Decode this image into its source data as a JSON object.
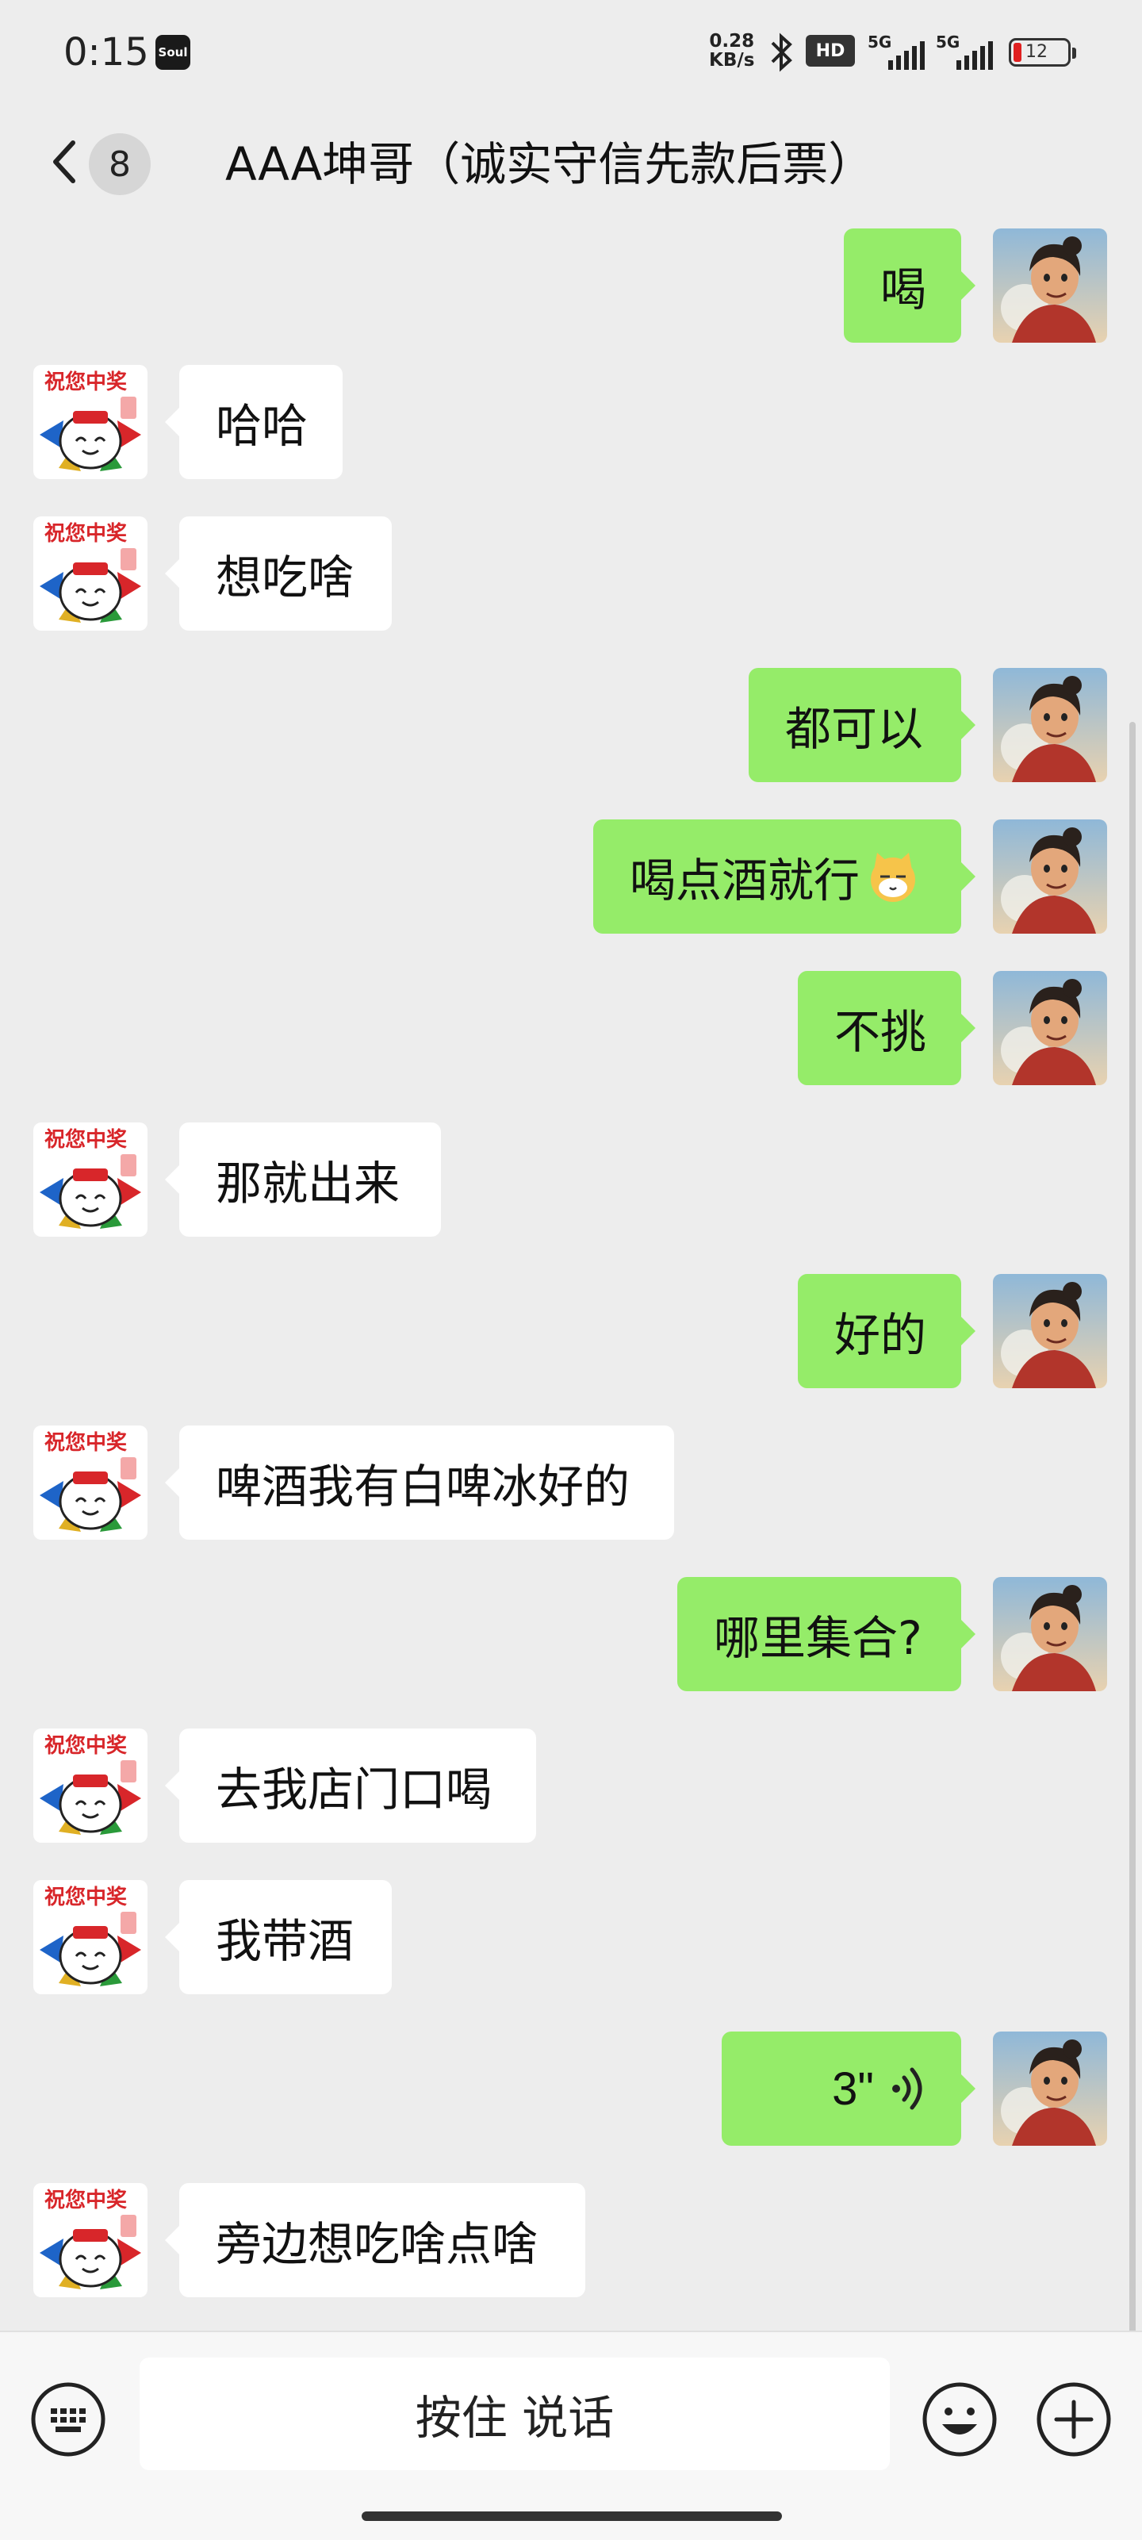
{
  "status_bar": {
    "time": "0:15",
    "app_icon_label": "Soul",
    "net_speed_value": "0.28",
    "net_speed_unit": "KB/s",
    "hd_label": "HD",
    "sim1": "5G",
    "sim2": "5G",
    "battery": "12"
  },
  "header": {
    "unread_count": "8",
    "title": "AAA坤哥（诚实守信先款后票）"
  },
  "messages": [
    {
      "side": "right",
      "text": "喝"
    },
    {
      "side": "left",
      "text": "哈哈"
    },
    {
      "side": "left",
      "text": "想吃啥"
    },
    {
      "side": "right",
      "text": "都可以"
    },
    {
      "side": "right",
      "text": "喝点酒就行",
      "emoji": "cat-face-emoji"
    },
    {
      "side": "right",
      "text": "不挑"
    },
    {
      "side": "left",
      "text": "那就出来"
    },
    {
      "side": "right",
      "text": "好的"
    },
    {
      "side": "left",
      "text": "啤酒我有白啤冰好的"
    },
    {
      "side": "right",
      "text": "哪里集合?"
    },
    {
      "side": "left",
      "text": "去我店门口喝"
    },
    {
      "side": "left",
      "text": "我带酒"
    },
    {
      "side": "right",
      "type": "voice",
      "text": "3\""
    },
    {
      "side": "left",
      "text": "旁边想吃啥点啥"
    }
  ],
  "avatars": {
    "left": {
      "badge_text": "祝您中奖"
    },
    "right": {}
  },
  "input_bar": {
    "talk_label": "按住 说话"
  },
  "colors": {
    "bubble_self": "#95ec69",
    "bubble_other": "#ffffff",
    "background": "#ededed"
  }
}
